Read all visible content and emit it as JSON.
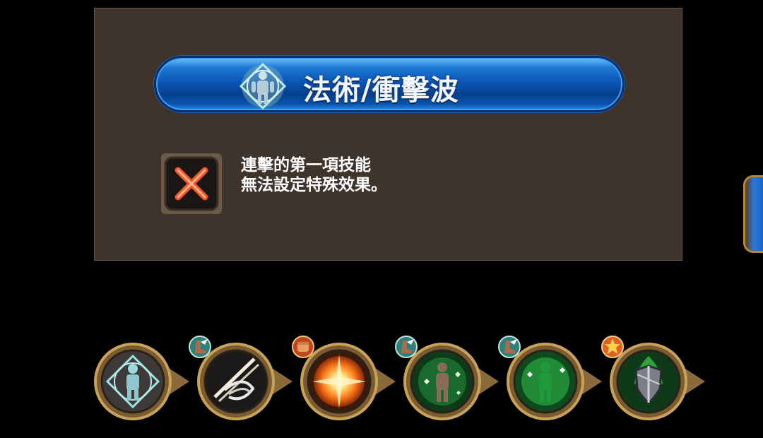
{
  "dialog": {
    "skill_name": "法術/衝擊波",
    "skill_icon": "humanoid-diamond-icon",
    "status_icon": "red-x-icon",
    "description_lines": [
      "連擊的第一項技能",
      "無法設定特殊效果。"
    ]
  },
  "skill_chain": [
    {
      "icon": "humanoid-diamond-icon",
      "badge": null,
      "selected": true
    },
    {
      "icon": "shockwave-slash-icon",
      "badge": "winged-boot-icon"
    },
    {
      "icon": "fire-burst-icon",
      "badge": "fist-icon"
    },
    {
      "icon": "green-aura-figure-icon",
      "badge": "winged-boot-icon"
    },
    {
      "icon": "green-glow-figure-icon",
      "badge": "winged-boot-icon"
    },
    {
      "icon": "shield-aura-icon",
      "badge": "star-icon"
    }
  ],
  "colors": {
    "panel_bg": "#3e342c",
    "banner_blue": "#0b57b8",
    "frame_gold": "#b08a4a"
  }
}
